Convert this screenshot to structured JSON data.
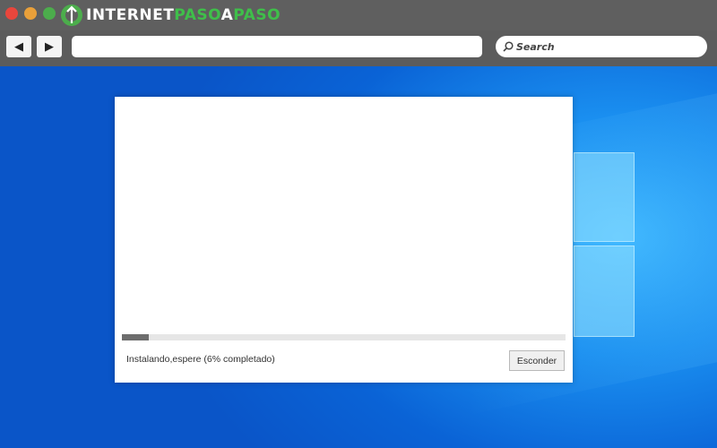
{
  "browser": {
    "logo": {
      "part1": "INTERNET",
      "part2": "PASO",
      "part3": "A",
      "part4": "PASO"
    },
    "back_glyph": "◀",
    "forward_glyph": "▶",
    "url_value": "",
    "search_placeholder": "Search",
    "colors": {
      "close": "#e8463c",
      "minimize": "#e9a03a",
      "maximize": "#4cad4c",
      "logo_green": "#3fbf4a"
    }
  },
  "installer": {
    "progress_percent": 6,
    "status": "Instalando,espere (6% completado)",
    "hide_label": "Esconder"
  }
}
